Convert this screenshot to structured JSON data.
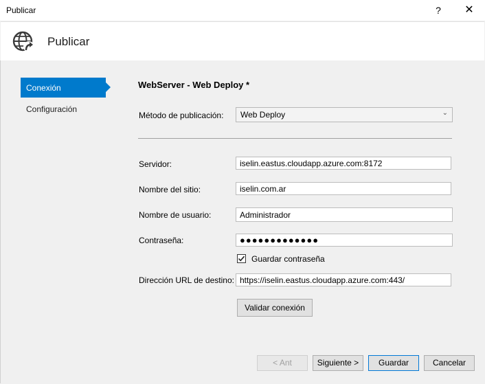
{
  "window": {
    "title": "Publicar",
    "help_label": "?",
    "close_label": "✕"
  },
  "header": {
    "title": "Publicar",
    "icon": "globe-publish-icon"
  },
  "nav": {
    "items": [
      {
        "label": "Conexión",
        "active": true
      },
      {
        "label": "Configuración",
        "active": false
      }
    ]
  },
  "main": {
    "section_title": "WebServer - Web Deploy *",
    "method": {
      "label": "Método de publicación:",
      "value": "Web Deploy"
    },
    "server": {
      "label": "Servidor:",
      "value": "iselin.eastus.cloudapp.azure.com:8172"
    },
    "site": {
      "label": "Nombre del sitio:",
      "value": "iselin.com.ar"
    },
    "user": {
      "label": "Nombre de usuario:",
      "value": "Administrador"
    },
    "password": {
      "label": "Contraseña:",
      "value": "●●●●●●●●●●●●●"
    },
    "save_password": {
      "label": "Guardar contraseña",
      "checked": true
    },
    "dest_url": {
      "label": "Dirección URL de destino:",
      "value": "https://iselin.eastus.cloudapp.azure.com:443/"
    },
    "validate_label": "Validar conexión"
  },
  "footer": {
    "back_label": "< Ant",
    "next_label": "Siguiente >",
    "save_label": "Guardar",
    "cancel_label": "Cancelar"
  },
  "colors": {
    "accent": "#007acc",
    "background": "#f0f0f0"
  }
}
